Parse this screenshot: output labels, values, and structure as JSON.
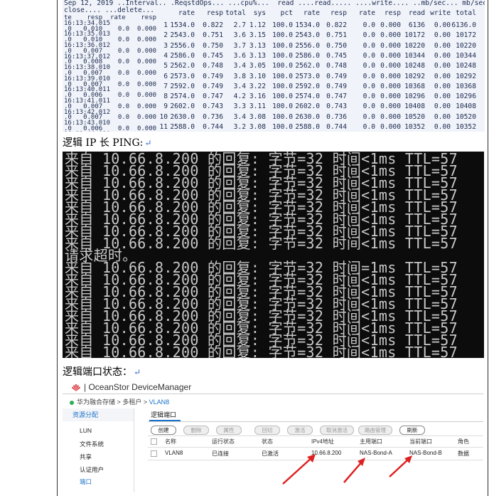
{
  "vdbench": {
    "header_line1": "Sep 12, 2019 ..Interval.. .ReqstdOps... ...cpu%...  read ....read..... ....write.... ..mb/sec... mb/sec",
    "header_line2_left": "close.... ...delete...",
    "columns": [
      "rate",
      "resp",
      "total",
      "sys",
      "pct",
      "rate",
      "resp",
      "rate",
      "resp",
      "read",
      "write",
      "total"
    ],
    "left_text": [
      "te    resp  rate    resp",
      "16:13:34.015",
      ".0   0.010    0.0  0.000",
      "16:13:35.013",
      ".0   0.010    0.0  0.000",
      "16:13:36.012",
      ".0   0.007    0.0  0.000",
      "16:13:37.012",
      ".0   0.008    0.0  0.000",
      "16:13:38.010",
      ".0   0.007    0.0  0.000",
      "16:13:39.010",
      ".0   0.007    0.0  0.000",
      "16:13:40.011",
      ".0   0.006    0.0  0.000",
      "16:13:41.011",
      ".0   0.007    0.0  0.000",
      "16:13:42.012",
      ".0   0.007    0.0  0.000",
      "16:13:43.010",
      ".0   0.006    0.0  0.000",
      "16:13:44.010"
    ],
    "rows": [
      [
        "1",
        "1534.0",
        "0.822",
        "2.7",
        "1.12",
        "100.0",
        "1534.0",
        "0.822",
        "0.0",
        "0.000",
        "6136",
        "0.00",
        "6136.0"
      ],
      [
        "2",
        "2543.0",
        "0.751",
        "3.6",
        "3.15",
        "100.0",
        "2543.0",
        "0.751",
        "0.0",
        "0.000",
        "10172",
        "0.00",
        "10172"
      ],
      [
        "3",
        "2556.0",
        "0.750",
        "3.7",
        "3.13",
        "100.0",
        "2556.0",
        "0.750",
        "0.0",
        "0.000",
        "10220",
        "0.00",
        "10220"
      ],
      [
        "4",
        "2586.0",
        "0.745",
        "3.6",
        "3.13",
        "100.0",
        "2586.0",
        "0.745",
        "0.0",
        "0.000",
        "10344",
        "0.00",
        "10344"
      ],
      [
        "5",
        "2562.0",
        "0.748",
        "3.4",
        "3.05",
        "100.0",
        "2562.0",
        "0.748",
        "0.0",
        "0.000",
        "10248",
        "0.00",
        "10248"
      ],
      [
        "6",
        "2573.0",
        "0.749",
        "3.8",
        "3.10",
        "100.0",
        "2573.0",
        "0.749",
        "0.0",
        "0.000",
        "10292",
        "0.00",
        "10292"
      ],
      [
        "7",
        "2592.0",
        "0.749",
        "3.4",
        "3.22",
        "100.0",
        "2592.0",
        "0.749",
        "0.0",
        "0.000",
        "10368",
        "0.00",
        "10368"
      ],
      [
        "8",
        "2574.0",
        "0.747",
        "4.2",
        "3.16",
        "100.0",
        "2574.0",
        "0.747",
        "0.0",
        "0.000",
        "10296",
        "0.00",
        "10296"
      ],
      [
        "9",
        "2602.0",
        "0.743",
        "3.3",
        "3.11",
        "100.0",
        "2602.0",
        "0.743",
        "0.0",
        "0.000",
        "10408",
        "0.00",
        "10408"
      ],
      [
        "10",
        "2630.0",
        "0.736",
        "3.4",
        "3.08",
        "100.0",
        "2630.0",
        "0.736",
        "0.0",
        "0.000",
        "10520",
        "0.00",
        "10520"
      ],
      [
        "11",
        "2588.0",
        "0.744",
        "3.2",
        "3.08",
        "100.0",
        "2588.0",
        "0.744",
        "0.0",
        "0.000",
        "10352",
        "0.00",
        "10352"
      ]
    ]
  },
  "caption_ping": "逻辑 IP 长 PING:",
  "caption_port": "逻辑端口状态：",
  "return_mark": "↵",
  "console_lines": [
    "来自 10.66.8.200 的回复: 字节=32 时间<1ms TTL=57",
    "来自 10.66.8.200 的回复: 字节=32 时间<1ms TTL=57",
    "来自 10.66.8.200 的回复: 字节=32 时间<1ms TTL=57",
    "来自 10.66.8.200 的回复: 字节=32 时间<1ms TTL=57",
    "来自 10.66.8.200 的回复: 字节=32 时间<1ms TTL=57",
    "来自 10.66.8.200 的回复: 字节=32 时间<1ms TTL=57",
    "来自 10.66.8.200 的回复: 字节=32 时间<1ms TTL=57",
    "来自 10.66.8.200 的回复: 字节=32 时间<1ms TTL=57",
    "请求超时。",
    "来自 10.66.8.200 的回复: 字节=32 时间=1ms TTL=57",
    "来自 10.66.8.200 的回复: 字节=32 时间<1ms TTL=57",
    "来自 10.66.8.200 的回复: 字节=32 时间<1ms TTL=57",
    "来自 10.66.8.200 的回复: 字节=32 时间<1ms TTL=57",
    "来自 10.66.8.200 的回复: 字节=32 时间<1ms TTL=57",
    "来自 10.66.8.200 的回复: 字节=32 时间<1ms TTL=57",
    "来自 10.66.8.200 的回复: 字节=32 时间<1ms TTL=57",
    "来自 10.66.8.200 的回复: 字节=32 时间<1ms TTL=57"
  ],
  "device_manager": {
    "app_title": "| OceanStor DeviceManager",
    "breadcrumb": [
      "华为融合存储",
      ">",
      "多租户",
      ">",
      "VLAN8"
    ],
    "sidebar_header": "资源分配",
    "sidebar_items": [
      "LUN",
      "文件系统",
      "共享",
      "认证用户",
      "端口"
    ],
    "tab_label": "逻辑端口",
    "toolbar": [
      "创建",
      "删除",
      "属性",
      "回切",
      "激活",
      "取消激活",
      "路由管理",
      "刷新"
    ],
    "columns": [
      "名称",
      "运行状态",
      "状态",
      "IPv4地址",
      "主用端口",
      "当前端口",
      "角色"
    ],
    "row": [
      "VLAN8",
      "已连接",
      "已激活",
      "10.66.8.200",
      "NAS-Bond-A",
      "NAS-Bond-B",
      "数据"
    ],
    "logo_icon": "huawei-logo-icon",
    "accent_color": "#1a73c9",
    "arrow_color": "#e02020"
  }
}
